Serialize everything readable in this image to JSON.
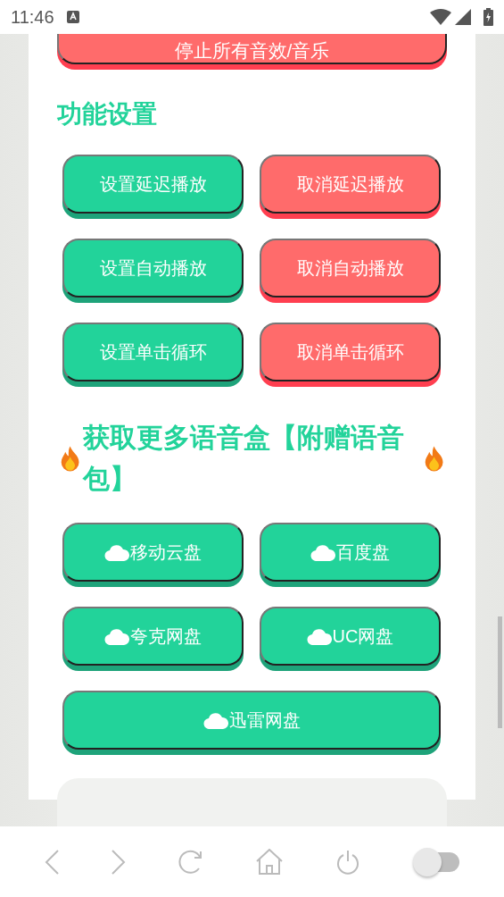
{
  "status_bar": {
    "time": "11:46"
  },
  "top_button": {
    "label": "停止所有音效/音乐",
    "kind": "red"
  },
  "sections": [
    {
      "title": "功能设置",
      "kind": "plain",
      "buttons": [
        {
          "label": "设置延迟播放",
          "kind": "green"
        },
        {
          "label": "取消延迟播放",
          "kind": "red"
        },
        {
          "label": "设置自动播放",
          "kind": "green"
        },
        {
          "label": "取消自动播放",
          "kind": "red"
        },
        {
          "label": "设置单击循环",
          "kind": "green"
        },
        {
          "label": "取消单击循环",
          "kind": "red"
        }
      ]
    },
    {
      "title": "获取更多语音盒【附赠语音包】",
      "kind": "flame",
      "buttons": [
        {
          "label": "移动云盘",
          "kind": "cloud"
        },
        {
          "label": "百度盘",
          "kind": "cloud"
        },
        {
          "label": "夸克网盘",
          "kind": "cloud"
        },
        {
          "label": "UC网盘",
          "kind": "cloud"
        },
        {
          "label": "迅雷网盘",
          "kind": "cloud-wide"
        }
      ]
    }
  ],
  "bottom_nav": {
    "toggle": {
      "on": false
    }
  }
}
